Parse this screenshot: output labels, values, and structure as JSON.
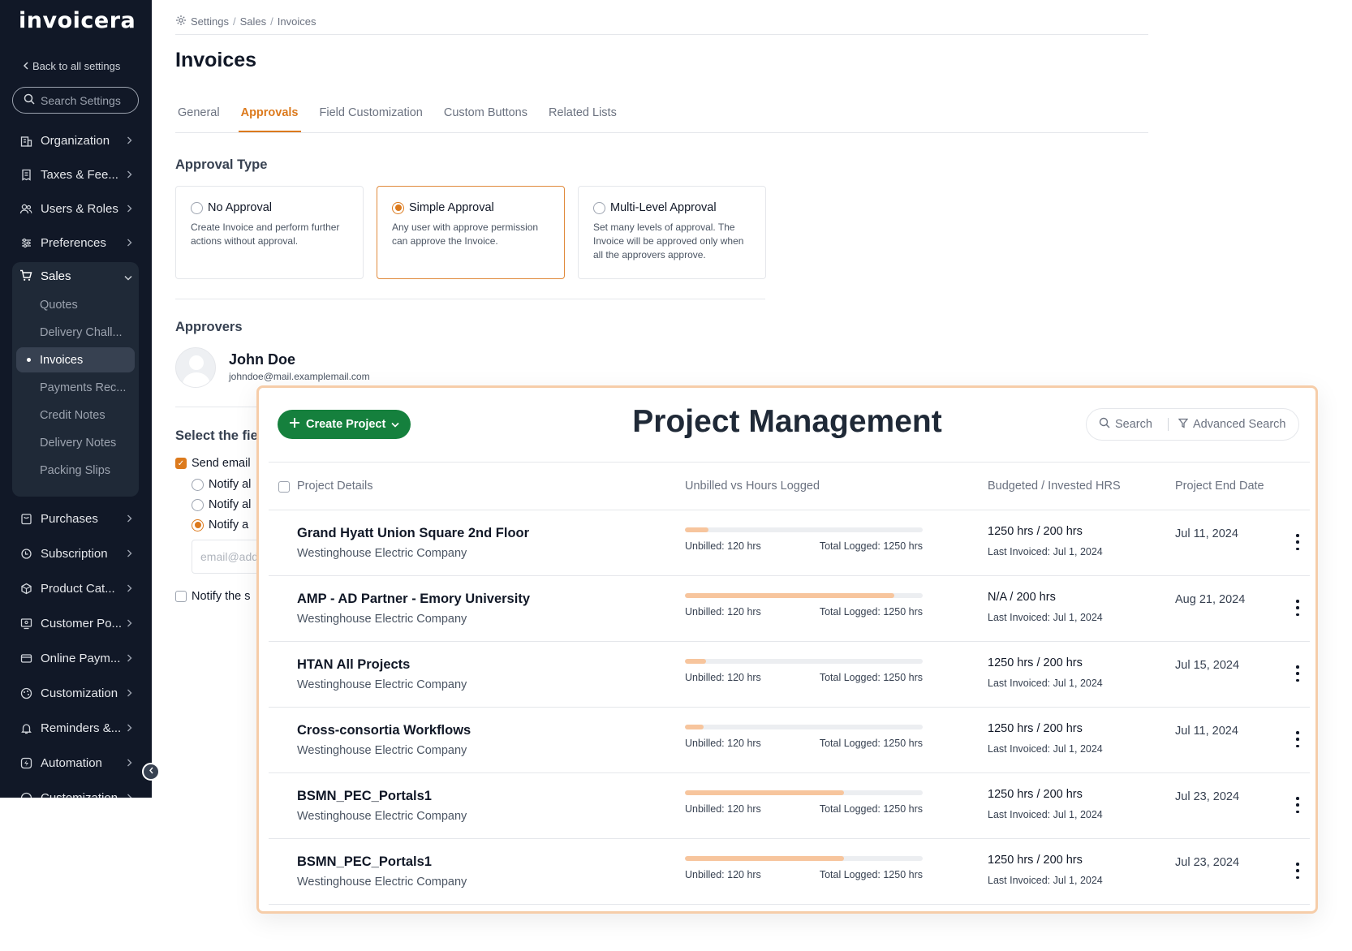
{
  "sidebar": {
    "logo": "invoicera",
    "back_label": "Back to all settings",
    "search_placeholder": "Search Settings",
    "items_top": [
      {
        "label": "Organization",
        "icon": "building-icon"
      },
      {
        "label": "Taxes & Fee...",
        "icon": "receipt-icon"
      },
      {
        "label": "Users & Roles",
        "icon": "users-icon"
      },
      {
        "label": "Preferences",
        "icon": "sliders-icon"
      }
    ],
    "sales": {
      "label": "Sales",
      "icon": "cart-icon",
      "sub_items": [
        "Quotes",
        "Delivery Chall...",
        "Invoices",
        "Payments Rec...",
        "Credit Notes",
        "Delivery Notes",
        "Packing Slips"
      ],
      "active": "Invoices"
    },
    "items_bottom": [
      {
        "label": "Purchases",
        "icon": "bag-icon"
      },
      {
        "label": "Subscription",
        "icon": "refresh-icon"
      },
      {
        "label": "Product Cat...",
        "icon": "box-icon"
      },
      {
        "label": "Customer Po...",
        "icon": "portal-icon"
      },
      {
        "label": "Online Paym...",
        "icon": "card-icon"
      },
      {
        "label": "Customization",
        "icon": "palette-icon"
      },
      {
        "label": "Reminders &...",
        "icon": "bell-icon"
      },
      {
        "label": "Automation",
        "icon": "bolt-icon"
      },
      {
        "label": "Customization",
        "icon": "palette-icon"
      }
    ]
  },
  "breadcrumb": {
    "items": [
      "Settings",
      "Sales",
      "Invoices"
    ],
    "separator": "/"
  },
  "page": {
    "title": "Invoices",
    "tabs": [
      "General",
      "Approvals",
      "Field Customization",
      "Custom Buttons",
      "Related Lists"
    ],
    "active_tab": "Approvals",
    "approval_type_title": "Approval Type",
    "approval_options": [
      {
        "title": "No Approval",
        "desc": "Create Invoice and perform further actions without approval.",
        "selected": false
      },
      {
        "title": "Simple Approval",
        "desc": "Any user with approve permission can approve the Invoice.",
        "selected": true
      },
      {
        "title": "Multi-Level Approval",
        "desc": "Set many levels of approval. The Invoice will be approved only when all the approvers approve.",
        "selected": false
      }
    ],
    "approvers_title": "Approvers",
    "approver": {
      "name": "John Doe",
      "email": "johndoe@mail.examplemail.com"
    },
    "select_field_title": "Select the fie",
    "send_email_label": "Send email",
    "notify_options": [
      "Notify al",
      "Notify al",
      "Notify a"
    ],
    "notify_selected_index": 2,
    "email_placeholder": "email@add",
    "notify_submitter_label": "Notify the s"
  },
  "project_panel": {
    "create_label": "Create Project",
    "title": "Project Management",
    "search_label": "Search",
    "advanced_search_label": "Advanced Search",
    "columns": [
      "Project Details",
      "Unbilled vs Hours Logged",
      "Budgeted / Invested HRS",
      "Project End Date"
    ],
    "rows": [
      {
        "name": "Grand Hyatt Union Square 2nd Floor",
        "company": "Westinghouse Electric Company",
        "progress": 0.1,
        "unbilled": "Unbilled: 120 hrs",
        "logged": "Total Logged: 1250 hrs",
        "budget": "1250 hrs / 200 hrs",
        "last_invoiced": "Last Invoiced: Jul 1, 2024",
        "end_date": "Jul 11, 2024"
      },
      {
        "name": "AMP - AD Partner - Emory University",
        "company": "Westinghouse Electric Company",
        "progress": 0.88,
        "unbilled": "Unbilled: 120 hrs",
        "logged": "Total Logged: 1250 hrs",
        "budget": "N/A / 200 hrs",
        "last_invoiced": "Last Invoiced: Jul 1, 2024",
        "end_date": "Aug 21, 2024"
      },
      {
        "name": "HTAN All Projects",
        "company": "Westinghouse Electric Company",
        "progress": 0.09,
        "unbilled": "Unbilled: 120 hrs",
        "logged": "Total Logged: 1250 hrs",
        "budget": "1250 hrs / 200 hrs",
        "last_invoiced": "Last Invoiced: Jul 1, 2024",
        "end_date": "Jul 15, 2024"
      },
      {
        "name": "Cross-consortia Workflows",
        "company": "Westinghouse Electric Company",
        "progress": 0.08,
        "unbilled": "Unbilled: 120 hrs",
        "logged": "Total Logged: 1250 hrs",
        "budget": "1250 hrs / 200 hrs",
        "last_invoiced": "Last Invoiced: Jul 1, 2024",
        "end_date": "Jul 11, 2024"
      },
      {
        "name": "BSMN_PEC_Portals1",
        "company": "Westinghouse Electric Company",
        "progress": 0.67,
        "unbilled": "Unbilled: 120 hrs",
        "logged": "Total Logged: 1250 hrs",
        "budget": "1250 hrs / 200 hrs",
        "last_invoiced": "Last Invoiced: Jul 1, 2024",
        "end_date": "Jul 23, 2024"
      },
      {
        "name": "BSMN_PEC_Portals1",
        "company": "Westinghouse Electric Company",
        "progress": 0.67,
        "unbilled": "Unbilled: 120 hrs",
        "logged": "Total Logged: 1250 hrs",
        "budget": "1250 hrs / 200 hrs",
        "last_invoiced": "Last Invoiced: Jul 1, 2024",
        "end_date": "Jul 23, 2024"
      }
    ]
  },
  "colors": {
    "accent": "#dc7a1d",
    "sidebar_bg": "#111827",
    "create_button": "#15803d",
    "progress_fill": "#f7c59d",
    "panel_border": "#f6cda9"
  }
}
